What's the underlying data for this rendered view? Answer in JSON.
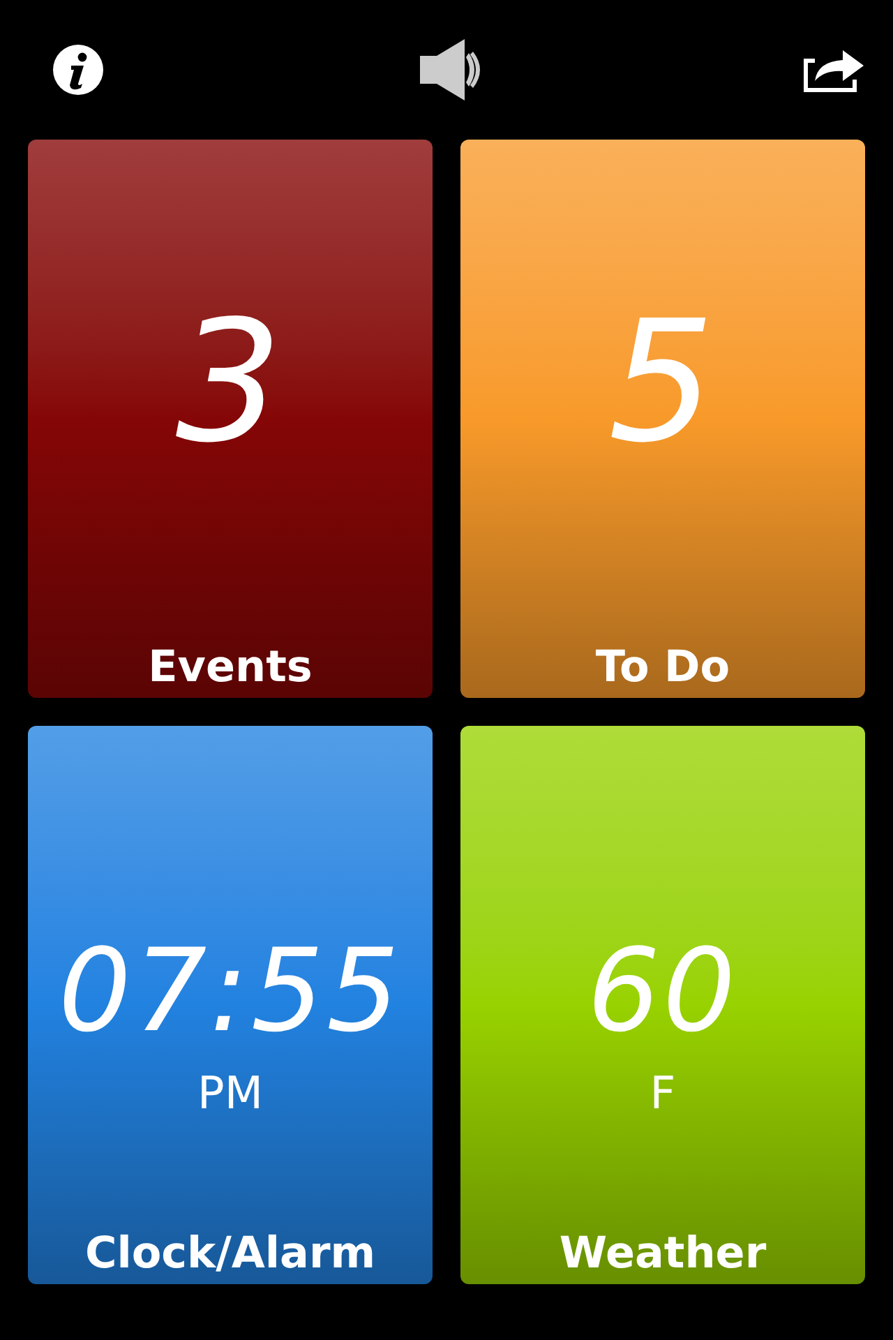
{
  "toolbar": {
    "buttons": [
      {
        "kind": "info"
      },
      {
        "kind": "sound"
      },
      {
        "kind": "share"
      }
    ]
  },
  "tiles": [
    {
      "value": "3",
      "label": "Events",
      "color": "#850606"
    },
    {
      "value": "5",
      "label": "To Do",
      "color": "#f89a2a"
    },
    {
      "value": "07:55",
      "unit": "PM",
      "label": "Clock/Alarm",
      "color": "#2282e0"
    },
    {
      "value": "60",
      "unit": "F",
      "label": "Weather",
      "color": "#98d200"
    }
  ]
}
